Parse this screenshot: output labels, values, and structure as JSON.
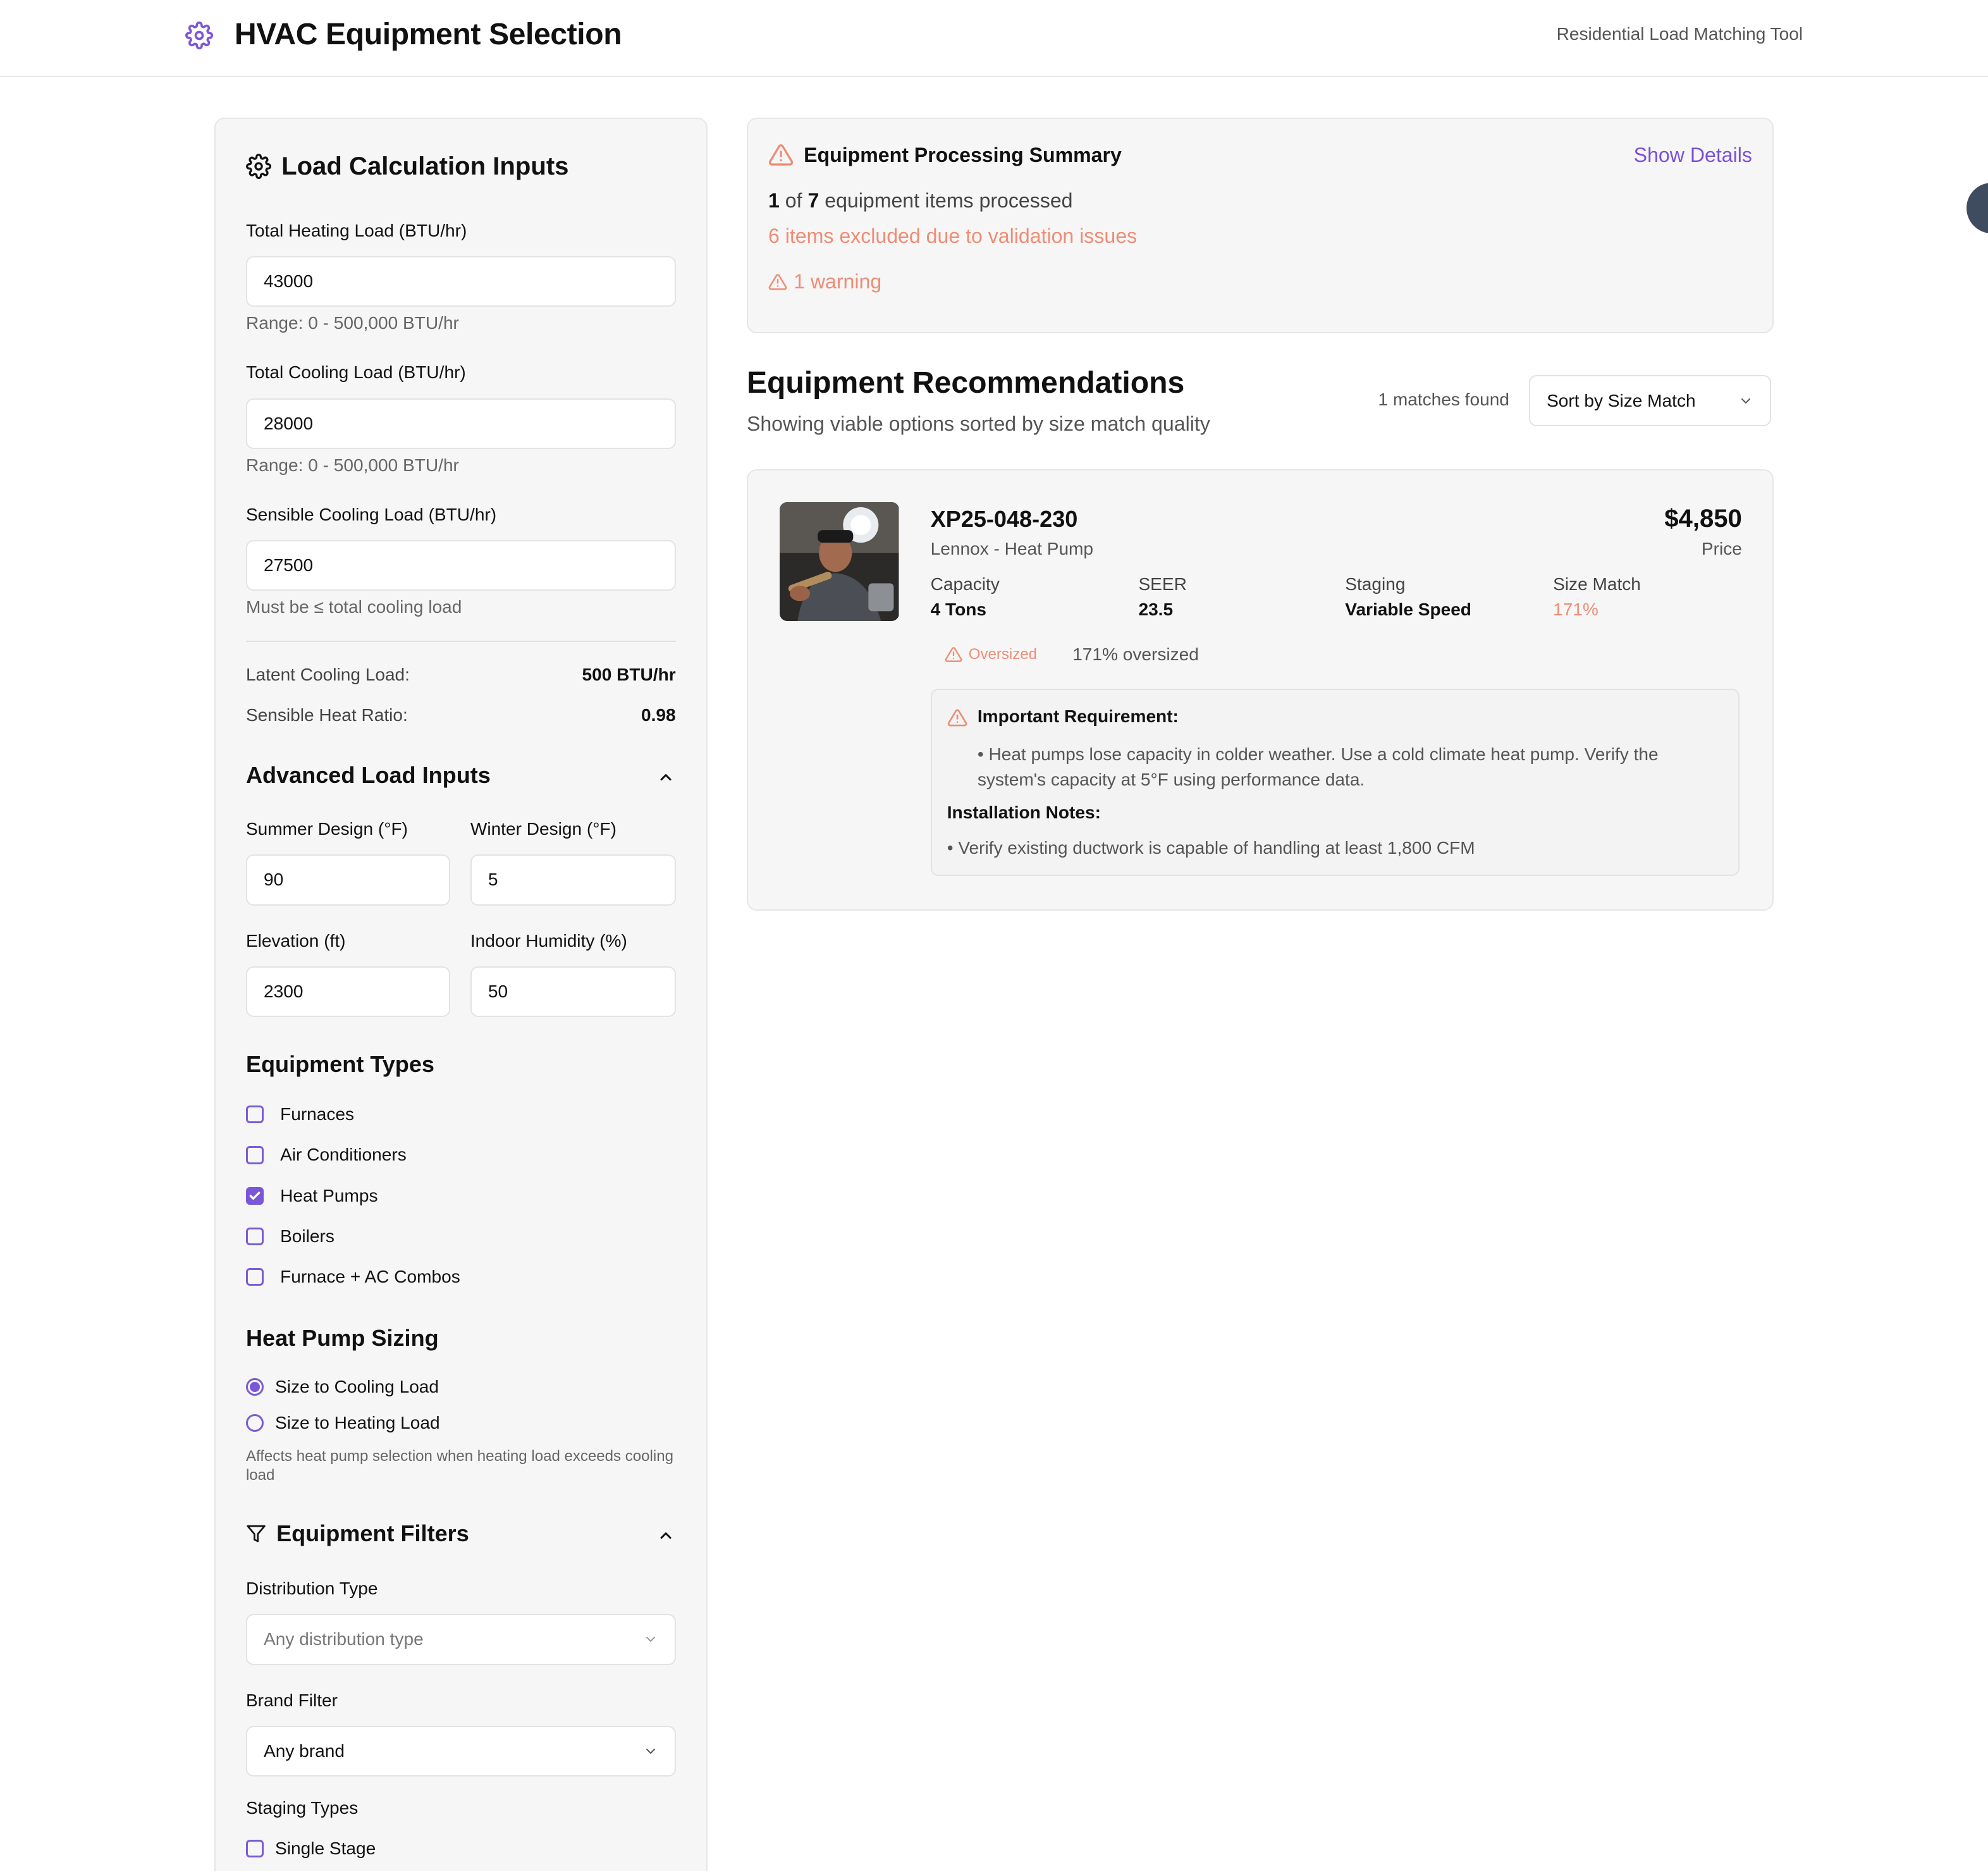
{
  "header": {
    "title": "HVAC Equipment Selection",
    "tool_label": "Residential Load Matching Tool",
    "logo_icon": "gear-icon",
    "accent_color": "#7b56d9"
  },
  "inputs": {
    "title": "Load Calculation Inputs",
    "heating": {
      "label": "Total Heating Load (BTU/hr)",
      "value": "43000",
      "hint": "Range: 0 - 500,000 BTU/hr"
    },
    "cooling": {
      "label": "Total Cooling Load (BTU/hr)",
      "value": "28000",
      "hint": "Range: 0 - 500,000 BTU/hr"
    },
    "sensible": {
      "label": "Sensible Cooling Load (BTU/hr)",
      "value": "27500",
      "hint": "Must be ≤ total cooling load"
    },
    "latent": {
      "label": "Latent Cooling Load:",
      "value": "500 BTU/hr"
    },
    "shr": {
      "label": "Sensible Heat Ratio:",
      "value": "0.98"
    }
  },
  "advanced": {
    "title": "Advanced Load Inputs",
    "summer": {
      "label": "Summer Design (°F)",
      "value": "90"
    },
    "winter": {
      "label": "Winter Design (°F)",
      "value": "5"
    },
    "elevation": {
      "label": "Elevation (ft)",
      "value": "2300"
    },
    "humidity": {
      "label": "Indoor Humidity (%)",
      "value": "50"
    }
  },
  "equipment_types": {
    "title": "Equipment Types",
    "items": [
      {
        "label": "Furnaces",
        "checked": false
      },
      {
        "label": "Air Conditioners",
        "checked": false
      },
      {
        "label": "Heat Pumps",
        "checked": true
      },
      {
        "label": "Boilers",
        "checked": false
      },
      {
        "label": "Furnace + AC Combos",
        "checked": false
      }
    ]
  },
  "hp_sizing": {
    "title": "Heat Pump Sizing",
    "options": [
      {
        "label": "Size to Cooling Load",
        "selected": true
      },
      {
        "label": "Size to Heating Load",
        "selected": false
      }
    ],
    "note": "Affects heat pump selection when heating load exceeds cooling load"
  },
  "filters": {
    "title": "Equipment Filters",
    "distribution": {
      "label": "Distribution Type",
      "placeholder": "Any distribution type"
    },
    "brand": {
      "label": "Brand Filter",
      "value": "Any brand"
    },
    "staging": {
      "label": "Staging Types",
      "first_option": "Single Stage"
    }
  },
  "summary": {
    "title": "Equipment Processing Summary",
    "show_details": "Show Details",
    "processed_count": "1",
    "processed_of": "of",
    "processed_total": "7",
    "processed_suffix": "equipment items processed",
    "excluded": "6 items excluded due to validation issues",
    "warnings": "1 warning",
    "warning_color": "#ef8c75"
  },
  "recommendations": {
    "title": "Equipment Recommendations",
    "subtitle": "Showing viable options sorted by size match quality",
    "matches": "1 matches found",
    "sort": "Sort by Size Match"
  },
  "result": {
    "model": "XP25-048-230",
    "brand": "Lennox - Heat Pump",
    "price": "$4,850",
    "price_label": "Price",
    "specs": [
      {
        "label": "Capacity",
        "value": "4 Tons"
      },
      {
        "label": "SEER",
        "value": "23.5"
      },
      {
        "label": "Staging",
        "value": "Variable Speed"
      },
      {
        "label": "Size Match",
        "value": "171%"
      }
    ],
    "badge": "Oversized",
    "oversized_text": "171% oversized",
    "requirement_title": "Important Requirement:",
    "requirement_text": "• Heat pumps lose capacity in colder weather. Use a cold climate heat pump. Verify the system's capacity at 5°F using performance data.",
    "install_title": "Installation Notes:",
    "install_text": "• Verify existing ductwork is capable of handling at least 1,800 CFM"
  }
}
